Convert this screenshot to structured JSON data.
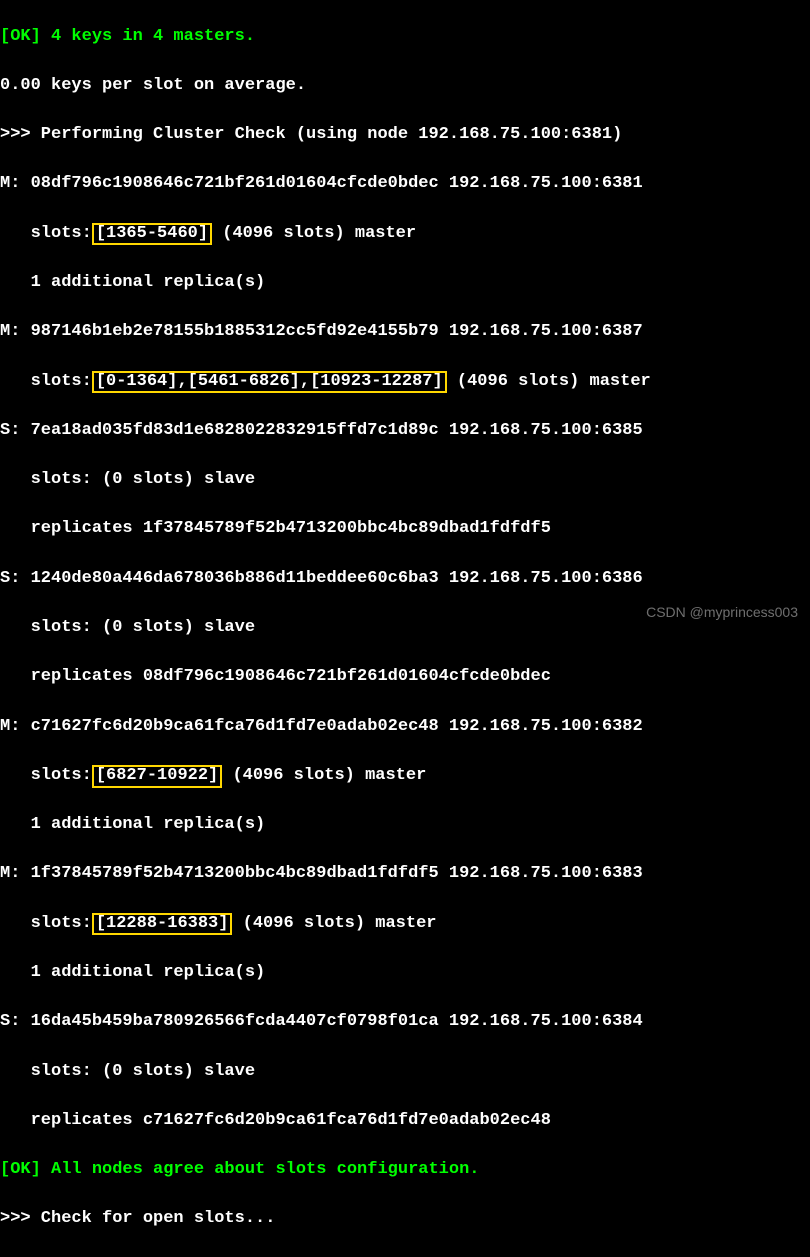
{
  "lines": {
    "ok_keys": "[OK] 4 keys in 4 masters.",
    "avg": "0.00 keys per slot on average.",
    "check_header": ">>> Performing Cluster Check (using node 192.168.75.100:6381)",
    "n1_a": "M: 08df796c1908646c721bf261d01604cfcde0bdec 192.168.75.100:6381",
    "n1_b_pre": "   slots:",
    "n1_b_hl": "[1365-5460]",
    "n1_b_post": " (4096 slots) master",
    "n1_c": "   1 additional replica(s)",
    "n2_a": "M: 987146b1eb2e78155b1885312cc5fd92e4155b79 192.168.75.100:6387",
    "n2_b_pre": "   slots:",
    "n2_b_hl": "[0-1364],[5461-6826],[10923-12287]",
    "n2_b_post": " (4096 slots) master",
    "n3_a": "S: 7ea18ad035fd83d1e6828022832915ffd7c1d89c 192.168.75.100:6385",
    "n3_b": "   slots: (0 slots) slave",
    "n3_c": "   replicates 1f37845789f52b4713200bbc4bc89dbad1fdfdf5",
    "n4_a": "S: 1240de80a446da678036b886d11beddee60c6ba3 192.168.75.100:6386",
    "n4_b": "   slots: (0 slots) slave",
    "n4_c": "   replicates 08df796c1908646c721bf261d01604cfcde0bdec",
    "n5_a": "M: c71627fc6d20b9ca61fca76d1fd7e0adab02ec48 192.168.75.100:6382",
    "n5_b_pre": "   slots:",
    "n5_b_hl": "[6827-10922]",
    "n5_b_post": " (4096 slots) master",
    "n5_c": "   1 additional replica(s)",
    "n6_a": "M: 1f37845789f52b4713200bbc4bc89dbad1fdfdf5 192.168.75.100:6383",
    "n6_b_pre": "   slots:",
    "n6_b_hl": "[12288-16383]",
    "n6_b_post": " (4096 slots) master",
    "n6_c": "   1 additional replica(s)",
    "n7_a": "S: 16da45b459ba780926566fcda4407cf0798f01ca 192.168.75.100:6384",
    "n7_b": "   slots: (0 slots) slave",
    "n7_c": "   replicates c71627fc6d20b9ca61fca76d1fd7e0adab02ec48",
    "ok_agree": "[OK] All nodes agree about slots configuration.",
    "check_open": ">>> Check for open slots..."
  },
  "watermark": "CSDN @myprincess003"
}
